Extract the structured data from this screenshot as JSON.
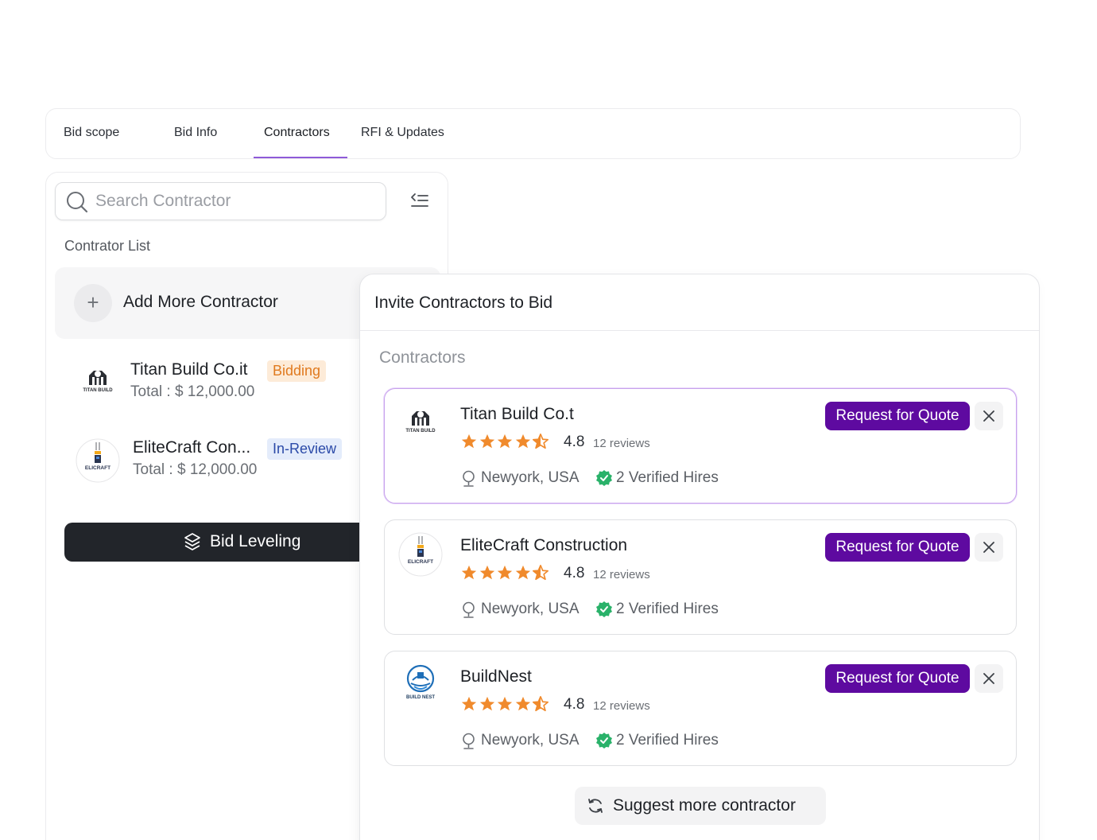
{
  "tabs": [
    {
      "label": "Bid scope"
    },
    {
      "label": "Bid Info"
    },
    {
      "label": "Contractors"
    },
    {
      "label": "RFI & Updates"
    }
  ],
  "active_tab": "Contractors",
  "sidebar": {
    "search_placeholder": "Search Contractor",
    "list_title": "Contrator List",
    "add_label": "Add More Contractor",
    "items": [
      {
        "name": "Titan Build Co.it",
        "badge": "Bidding",
        "total": "Total : $ 12,000.00",
        "logo_text": "TITAN BUILD"
      },
      {
        "name": "EliteCraft Con...",
        "badge": "In-Review",
        "total": "Total : $ 12,000.00",
        "logo_text": "ELICRAFT"
      }
    ],
    "bid_leveling_label": "Bid Leveling"
  },
  "invite": {
    "title": "Invite Contractors to Bid",
    "subtitle": "Contractors",
    "cards": [
      {
        "name": "Titan Build Co.t",
        "rating": "4.8",
        "reviews": "12 reviews",
        "location": "Newyork, USA",
        "verified": "2 Verified Hires",
        "logo_text": "TITAN BUILD",
        "selected": true
      },
      {
        "name": "EliteCraft Construction",
        "rating": "4.8",
        "reviews": "12 reviews",
        "location": "Newyork, USA",
        "verified": "2 Verified Hires",
        "logo_text": "ELICRAFT",
        "selected": false
      },
      {
        "name": "BuildNest",
        "rating": "4.8",
        "reviews": "12 reviews",
        "location": "Newyork, USA",
        "verified": "2 Verified Hires",
        "logo_text": "BUILD NEST",
        "selected": false
      }
    ],
    "rfq_label": "Request for Quote",
    "suggest_label": "Suggest more contractor"
  },
  "colors": {
    "accent_purple": "#5e0aa0",
    "tab_underline": "#8e5ad8",
    "star_orange": "#f08a2c",
    "verified_green": "#2ab26a",
    "bidding_badge": "#e07a1f",
    "review_badge": "#2b4aa8"
  },
  "icons": [
    "search-icon",
    "collapse-sidebar-icon",
    "plus-icon",
    "layers-icon",
    "star-icon",
    "star-half-icon",
    "location-pin-icon",
    "verified-badge-icon",
    "close-icon",
    "refresh-icon"
  ]
}
